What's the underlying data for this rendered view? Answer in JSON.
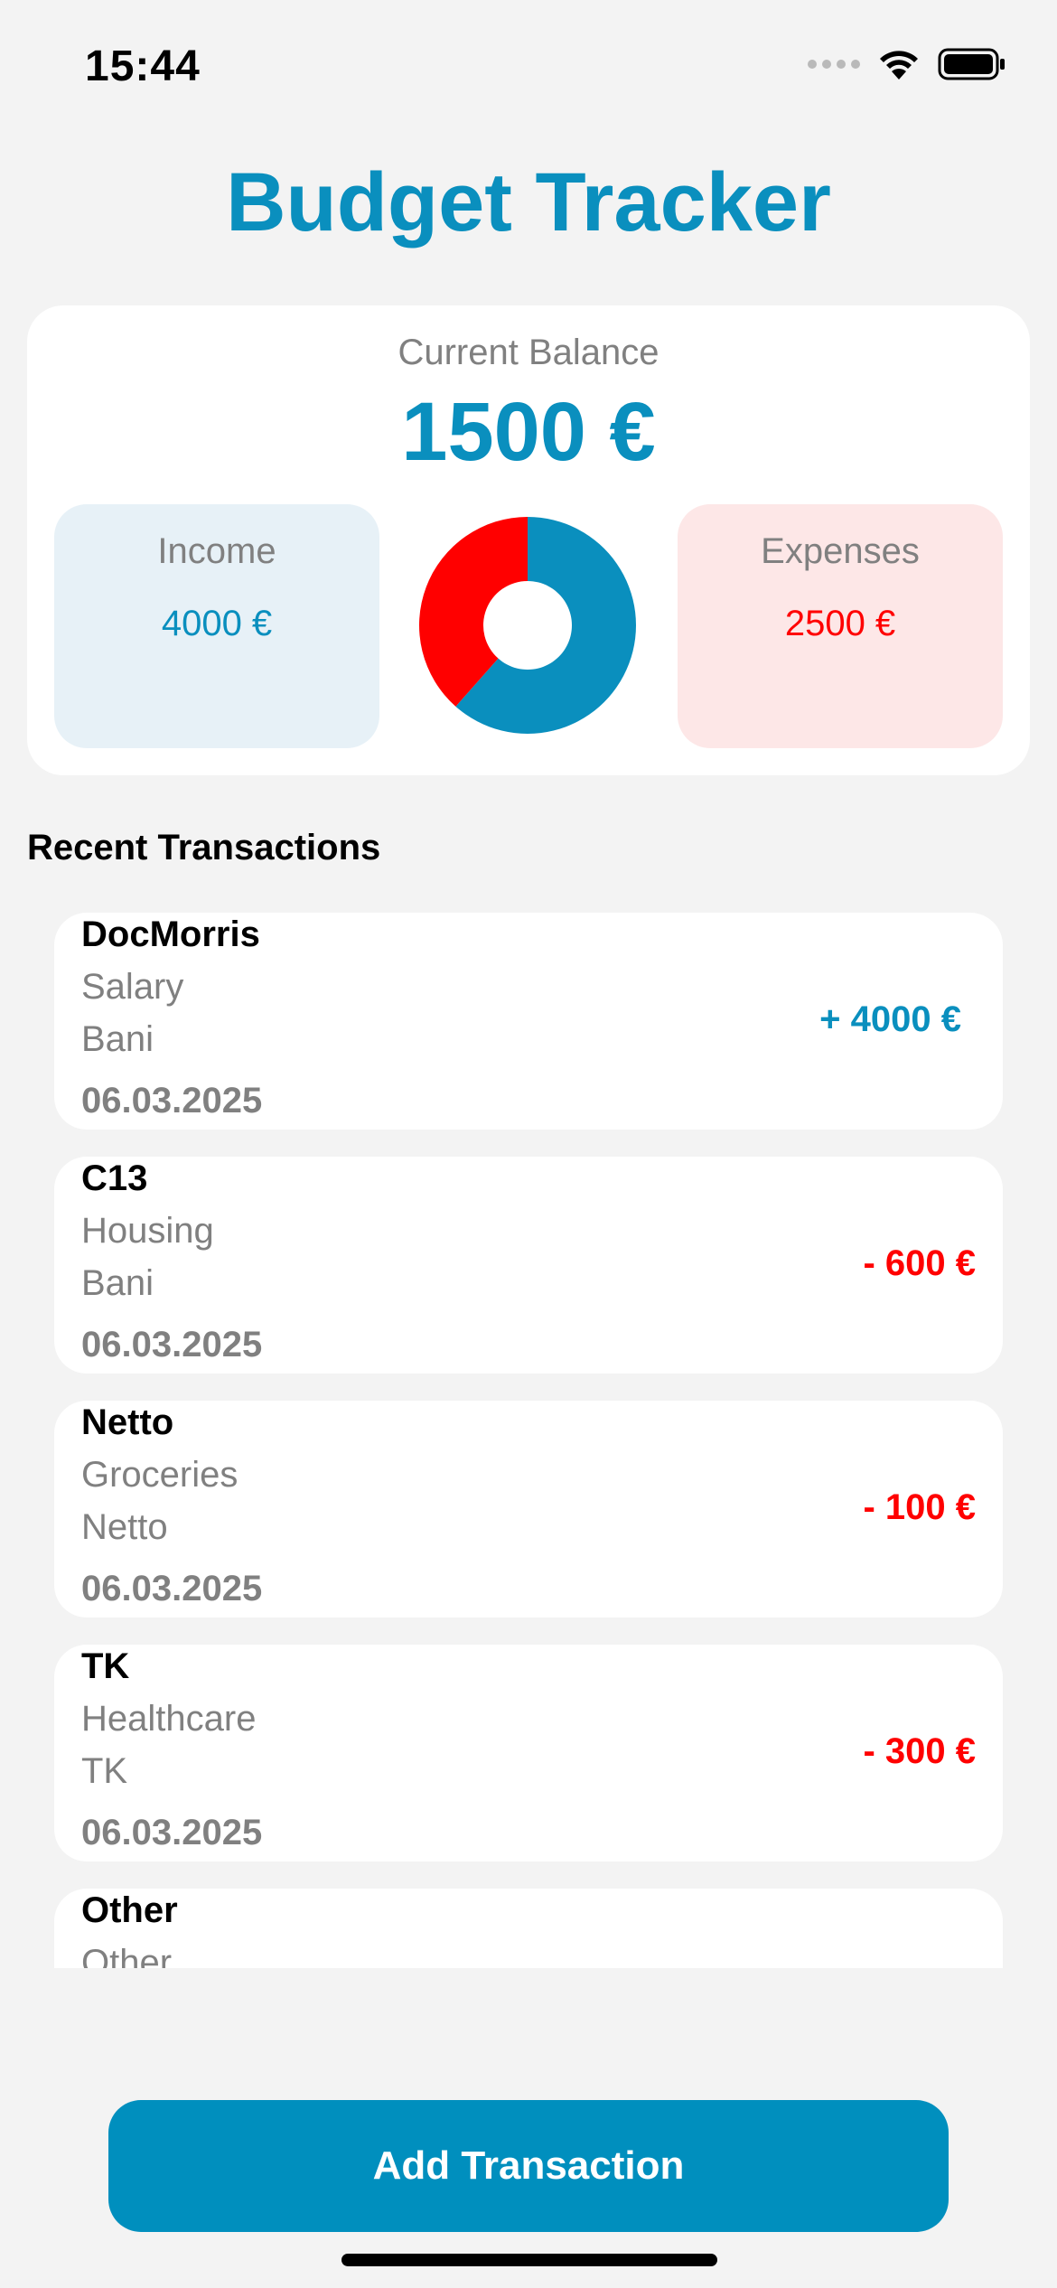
{
  "status_bar": {
    "time": "15:44",
    "icons": [
      "cellular-signal-icon",
      "wifi-icon",
      "battery-icon"
    ]
  },
  "app": {
    "title": "Budget Tracker"
  },
  "balance": {
    "label": "Current Balance",
    "value": "1500 €",
    "income_label": "Income",
    "income_value": "4000 €",
    "expenses_label": "Expenses",
    "expenses_value": "2500 €"
  },
  "chart_data": {
    "type": "pie",
    "categories": [
      "Income",
      "Expenses"
    ],
    "values": [
      4000,
      2500
    ],
    "colors": [
      "#0a8fbe",
      "#ff0000"
    ]
  },
  "transactions": {
    "title": "Recent Transactions",
    "items": [
      {
        "name": "DocMorris",
        "category": "Salary",
        "payee": "Bani",
        "date": "06.03.2025",
        "amount": "+ 4000 €",
        "type": "income"
      },
      {
        "name": "C13",
        "category": "Housing",
        "payee": "Bani",
        "date": "06.03.2025",
        "amount": "- 600 €",
        "type": "expense"
      },
      {
        "name": "Netto",
        "category": "Groceries",
        "payee": "Netto",
        "date": "06.03.2025",
        "amount": "- 100 €",
        "type": "expense"
      },
      {
        "name": "TK",
        "category": "Healthcare",
        "payee": "TK",
        "date": "06.03.2025",
        "amount": "- 300 €",
        "type": "expense"
      },
      {
        "name": "Other",
        "category": "Other",
        "payee": "",
        "date": "",
        "amount": "",
        "type": "expense"
      }
    ]
  },
  "actions": {
    "add_label": "Add Transaction"
  },
  "colors": {
    "accent": "#0a8fbe",
    "button": "#008fbe",
    "expense": "#ff0000",
    "background": "#f3f3f3"
  }
}
